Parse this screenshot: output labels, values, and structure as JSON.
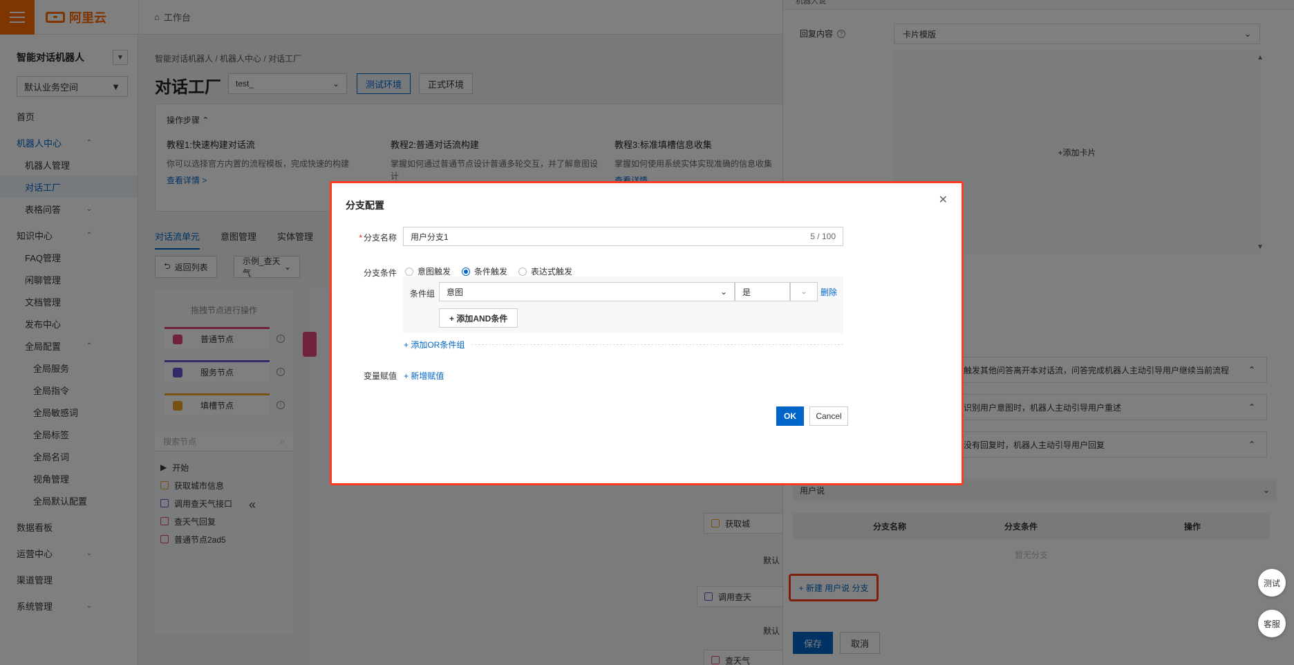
{
  "topbar": {
    "brand": "阿里云",
    "workbench": "工作台"
  },
  "sidebar": {
    "title": "智能对话机器人",
    "workspace": "默认业务空间",
    "items": [
      {
        "label": "首页",
        "level": 1
      },
      {
        "label": "机器人中心",
        "level": 1,
        "blue": true,
        "chev": "⌃"
      },
      {
        "label": "机器人管理",
        "level": 2
      },
      {
        "label": "对话工厂",
        "level": 2,
        "active": true
      },
      {
        "label": "表格问答",
        "level": 2,
        "chev": "⌄"
      },
      {
        "label": "知识中心",
        "level": 1,
        "chev": "⌃"
      },
      {
        "label": "FAQ管理",
        "level": 2
      },
      {
        "label": "闲聊管理",
        "level": 2
      },
      {
        "label": "文档管理",
        "level": 2
      },
      {
        "label": "发布中心",
        "level": 2
      },
      {
        "label": "全局配置",
        "level": 2,
        "chev": "⌃"
      },
      {
        "label": "全局服务",
        "level": 3
      },
      {
        "label": "全局指令",
        "level": 3
      },
      {
        "label": "全局敏感词",
        "level": 3
      },
      {
        "label": "全局标签",
        "level": 3
      },
      {
        "label": "全局名词",
        "level": 3
      },
      {
        "label": "视角管理",
        "level": 3
      },
      {
        "label": "全局默认配置",
        "level": 3
      },
      {
        "label": "数据看板",
        "level": 1
      },
      {
        "label": "运营中心",
        "level": 1,
        "chev": "⌄"
      },
      {
        "label": "渠道管理",
        "level": 1
      },
      {
        "label": "系统管理",
        "level": 1,
        "chev": "⌄"
      }
    ]
  },
  "main": {
    "breadcrumb": "智能对话机器人  /  机器人中心  /  对话工厂",
    "title": "对话工厂",
    "env_value": "test_",
    "env_test": "测试环境",
    "env_prod": "正式环境",
    "steps_head": "操作步骤 ⌃",
    "tutorials": [
      {
        "title": "教程1:快速构建对话流",
        "desc": "你可以选择官方内置的流程模板，完成快速的构建",
        "link": "查看详情 >"
      },
      {
        "title": "教程2:普通对话流构建",
        "desc": "掌握如何通过普通节点设计普通多轮交互，并了解意图设计",
        "link": ""
      },
      {
        "title": "教程3:标准填槽信息收集",
        "desc": "掌握如何使用系统实体实现准确的信息收集",
        "link": "查看详情"
      }
    ],
    "tabs": [
      "对话流单元",
      "意图管理",
      "实体管理"
    ],
    "back_btn": "返回列表",
    "flow_select": "示例_查天气",
    "palette_head": "拖拽节点进行操作",
    "nodes": [
      "普通节点",
      "服务节点",
      "填槽节点"
    ],
    "search_placeholder": "搜索节点",
    "tree": [
      "开始",
      "获取城市信息",
      "调用查天气接口",
      "查天气回复",
      "普通节点2ad5"
    ],
    "canvas_nodes": [
      "获取城",
      "默认",
      "调用查天",
      "默认",
      "查天气"
    ]
  },
  "drawer": {
    "top_label": "机器人说",
    "reply_label": "回复内容",
    "reply_value": "卡片模版",
    "add_card": "+添加卡片",
    "rows": [
      "触发其他问答离开本对话流，问答完成机器人主动引导用户继续当前流程",
      "识别用户意图时，机器人主动引导用户重述",
      "没有回复时，机器人主动引导用户回复"
    ],
    "user_says": "用户说",
    "col_name": "分支名称",
    "col_cond": "分支条件",
    "col_op": "操作",
    "empty": "暂无分支",
    "new_branch": "+ 新建 用户说 分支",
    "save": "保存",
    "cancel": "取消"
  },
  "float": {
    "test": "测试",
    "service": "客服"
  },
  "modal": {
    "title": "分支配置",
    "name_label": "分支名称",
    "name_value": "用户分支1",
    "name_count": "5 / 100",
    "cond_label": "分支条件",
    "radio_intent": "意图触发",
    "radio_cond": "条件触发",
    "radio_expr": "表达式触发",
    "group_label": "条件组",
    "cond_select": "意图",
    "cond_value": "是",
    "delete": "删除",
    "add_and": "+ 添加AND条件",
    "add_or": "+ 添加OR条件组",
    "var_label": "变量赋值",
    "add_var": "+ 新增赋值",
    "ok": "OK",
    "cancel": "Cancel"
  }
}
